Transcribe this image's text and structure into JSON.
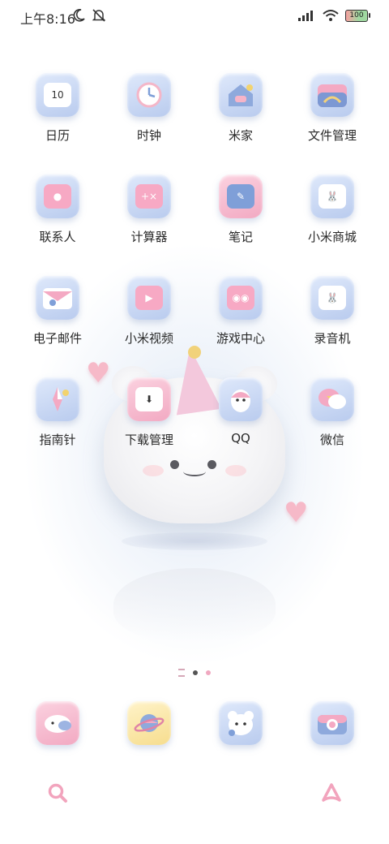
{
  "status_bar": {
    "time": "上午8:16",
    "battery_level": "100"
  },
  "apps": [
    {
      "label": "日历",
      "icon": "calendar-icon",
      "badge_text": "10"
    },
    {
      "label": "时钟",
      "icon": "clock-icon"
    },
    {
      "label": "米家",
      "icon": "home-icon"
    },
    {
      "label": "文件管理",
      "icon": "folder-icon"
    },
    {
      "label": "联系人",
      "icon": "contacts-icon"
    },
    {
      "label": "计算器",
      "icon": "calculator-icon"
    },
    {
      "label": "笔记",
      "icon": "notes-icon"
    },
    {
      "label": "小米商城",
      "icon": "shopping-bag-icon"
    },
    {
      "label": "电子邮件",
      "icon": "mail-icon"
    },
    {
      "label": "小米视频",
      "icon": "video-icon"
    },
    {
      "label": "游戏中心",
      "icon": "gamepad-icon"
    },
    {
      "label": "录音机",
      "icon": "recorder-icon"
    },
    {
      "label": "指南针",
      "icon": "compass-icon"
    },
    {
      "label": "下载管理",
      "icon": "download-icon"
    },
    {
      "label": "QQ",
      "icon": "penguin-icon"
    },
    {
      "label": "微信",
      "icon": "chat-bubble-icon"
    }
  ],
  "dock": [
    {
      "icon": "message-icon"
    },
    {
      "icon": "browser-planet-icon"
    },
    {
      "icon": "bear-face-icon"
    },
    {
      "icon": "camera-icon"
    }
  ],
  "bottom_bar": {
    "left_icon": "search-icon",
    "right_icon": "assistant-icon"
  },
  "page_indicator": {
    "pages": 3,
    "current": 2
  }
}
